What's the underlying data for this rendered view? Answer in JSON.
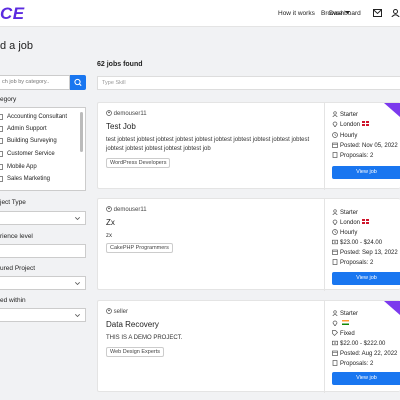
{
  "nav": {
    "logo": "CE",
    "links": [
      "How it works",
      "Browse",
      "Dashboard"
    ],
    "icons": [
      "envelope-icon",
      "user-icon"
    ]
  },
  "sidebar": {
    "title": "d a job",
    "search_placeholder": "ch job by category..",
    "category_label": "egory",
    "categories": [
      "Accounting Consultant",
      "Admin Support",
      "Building Surveying",
      "Customer Service",
      "Mobile App",
      "Sales Marketing"
    ],
    "filters": [
      {
        "label": "ject Type"
      },
      {
        "label": "rience level"
      },
      {
        "label": "ured Project"
      },
      {
        "label": "ed within"
      }
    ]
  },
  "main": {
    "jobs_found": "62 jobs found",
    "search_placeholder": "Type Skill"
  },
  "jobs": [
    {
      "user": "demouser11",
      "title": "Test Job",
      "description": "test jobtest jobtest jobtest jobtest jobtest jobtest jobtest jobtest jobtest jobtest jobtest jobtest jobtest jobtest jobtest job",
      "tag": "WordPress Developers",
      "level": "Starter",
      "location": "London",
      "type": "Hourly",
      "budget": "",
      "posted": "Posted: Nov 05, 2022",
      "proposals": "Proposals: 2",
      "button": "View job"
    },
    {
      "user": "demouser11",
      "title": "Zx",
      "description": "zx",
      "tag": "CakePHP Programmers",
      "level": "Starter",
      "location": "London",
      "type": "Hourly",
      "budget": "$23.00 - $24.00",
      "posted": "Posted: Sep 13, 2022",
      "proposals": "Proposals: 2",
      "button": "View job"
    },
    {
      "user": "seller",
      "title": "Data Recovery",
      "description": "THIS IS A DEMO PROJECT.",
      "tag": "Web Design Experts",
      "level": "Starter",
      "location": "",
      "type": "Fixed",
      "budget": "$22.00 - $222.00",
      "posted": "Posted: Aug 22, 2022",
      "proposals": "Proposals: 2",
      "button": "View job"
    }
  ],
  "colors": {
    "brand": "#5b2be0",
    "primary": "#1976f0",
    "ribbon": "#7c3aed"
  }
}
